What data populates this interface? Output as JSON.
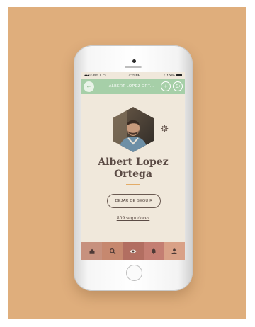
{
  "status_bar": {
    "carrier": "BELL",
    "time": "4:21 PM",
    "battery": "100%"
  },
  "navbar": {
    "title": "ALBERT LOPEZ ORT..."
  },
  "profile": {
    "name_line1": "Albert Lopez",
    "name_line2": "Ortega",
    "follow_button_label": "DEJAR DE SEGUIR",
    "followers_text": "859 seguidores"
  },
  "tabbar": {
    "items": [
      "home",
      "search",
      "eye",
      "bell",
      "user"
    ],
    "active": "eye"
  },
  "colors": {
    "backdrop": "#dfae7c",
    "navbar": "#a6cfa8",
    "screen_background": "#f0e8db",
    "accent_divider": "#e3ac68"
  }
}
